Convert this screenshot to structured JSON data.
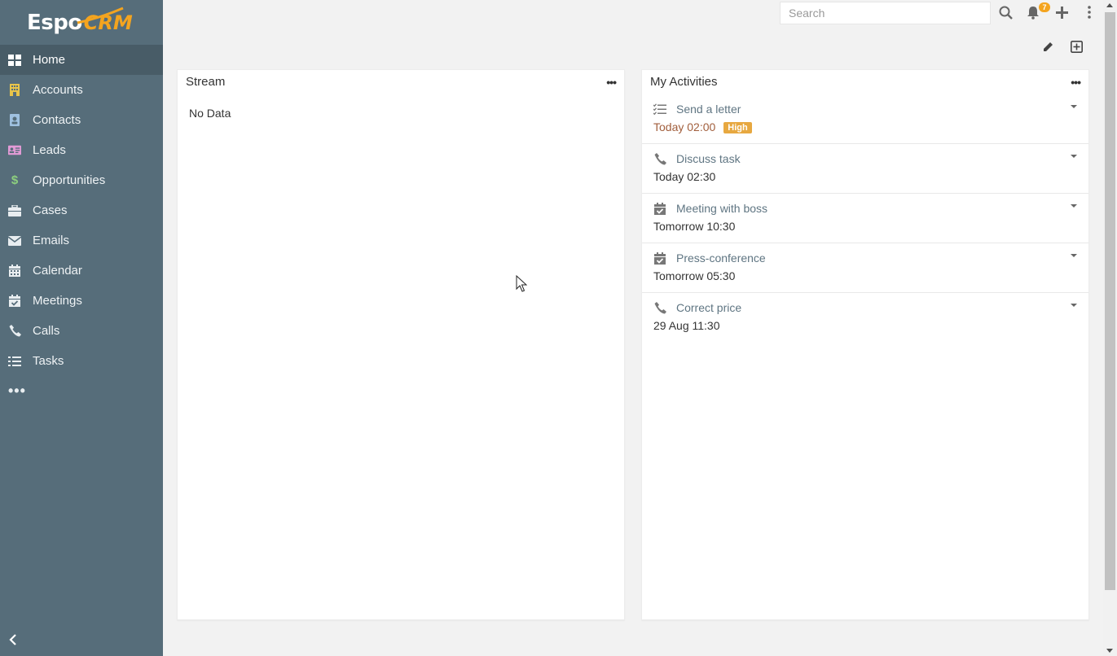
{
  "app": {
    "logo_text_1": "Espo",
    "logo_text_2": "CRM",
    "brand_color": "#f4a41f",
    "sidebar_color": "#566d7a"
  },
  "sidebar": {
    "items": [
      {
        "label": "Home",
        "icon": "grid-icon",
        "color": "#ffffff",
        "active": true
      },
      {
        "label": "Accounts",
        "icon": "building-icon",
        "color": "#e8c44a"
      },
      {
        "label": "Contacts",
        "icon": "contact-card-icon",
        "color": "#9fc1e0"
      },
      {
        "label": "Leads",
        "icon": "id-card-icon",
        "color": "#e29bd6"
      },
      {
        "label": "Opportunities",
        "icon": "dollar-icon",
        "color": "#8dcf7e"
      },
      {
        "label": "Cases",
        "icon": "briefcase-icon",
        "color": "#e8edf0"
      },
      {
        "label": "Emails",
        "icon": "envelope-icon",
        "color": "#e8edf0"
      },
      {
        "label": "Calendar",
        "icon": "calendar-icon",
        "color": "#e8edf0"
      },
      {
        "label": "Meetings",
        "icon": "calendar-check-icon",
        "color": "#e8edf0"
      },
      {
        "label": "Calls",
        "icon": "phone-icon",
        "color": "#e8edf0"
      },
      {
        "label": "Tasks",
        "icon": "tasks-icon",
        "color": "#e8edf0"
      }
    ],
    "more_label": "•••",
    "collapse_label": "‹"
  },
  "header": {
    "search_placeholder": "Search",
    "notification_count": "7"
  },
  "dashboard": {
    "stream": {
      "title": "Stream",
      "empty_text": "No Data"
    },
    "activities": {
      "title": "My Activities",
      "items": [
        {
          "name": "Send a letter",
          "type": "task",
          "date": "Today 02:00",
          "overdue": true,
          "priority": "High"
        },
        {
          "name": "Discuss task",
          "type": "call",
          "date": "Today 02:30",
          "overdue": false
        },
        {
          "name": "Meeting with boss",
          "type": "meeting",
          "date": "Tomorrow 10:30",
          "overdue": false
        },
        {
          "name": "Press-conference",
          "type": "meeting",
          "date": "Tomorrow 05:30",
          "overdue": false
        },
        {
          "name": "Correct price",
          "type": "call",
          "date": "29 Aug 11:30",
          "overdue": false
        }
      ]
    },
    "menu_label": "•••"
  }
}
